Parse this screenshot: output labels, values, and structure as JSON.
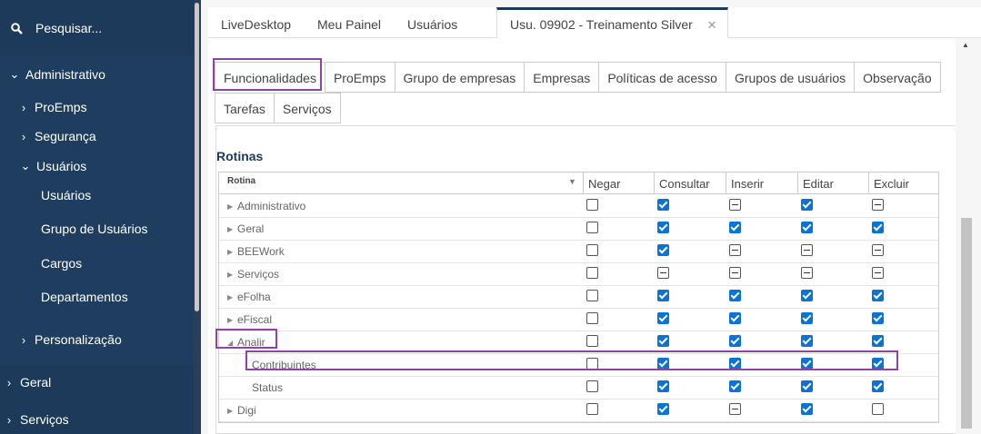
{
  "sidebar": {
    "search_label": "Pesquisar...",
    "items": [
      {
        "label": "Administrativo"
      },
      {
        "label": "ProEmps"
      },
      {
        "label": "Segurança"
      },
      {
        "label": "Usuários"
      },
      {
        "label": "Usuários"
      },
      {
        "label": "Grupo de Usuários"
      },
      {
        "label": "Cargos"
      },
      {
        "label": "Departamentos"
      },
      {
        "label": "Personalização"
      },
      {
        "label": "Geral"
      },
      {
        "label": "Serviços"
      }
    ]
  },
  "top_tabs": [
    "LiveDesktop",
    "Meu Painel",
    "Usuários",
    "Usu. 09902 - Treinamento Silver"
  ],
  "form_tabs_row1": [
    "Funcionalidades",
    "ProEmps",
    "Grupo de empresas",
    "Empresas",
    "Políticas de acesso",
    "Grupos de usuários",
    "Observação"
  ],
  "form_tabs_row2": [
    "Tarefas",
    "Serviços"
  ],
  "section_title": "Rotinas",
  "grid": {
    "columns": [
      "Rotina",
      "Negar",
      "Consultar",
      "Inserir",
      "Editar",
      "Excluir"
    ],
    "rows": [
      {
        "label": "Administrativo",
        "states": [
          "n",
          "c",
          "i",
          "c",
          "i"
        ]
      },
      {
        "label": "Geral",
        "states": [
          "n",
          "c",
          "c",
          "c",
          "c"
        ]
      },
      {
        "label": "BEEWork",
        "states": [
          "n",
          "c",
          "i",
          "i",
          "i"
        ]
      },
      {
        "label": "Serviços",
        "states": [
          "n",
          "i",
          "i",
          "i",
          "i"
        ]
      },
      {
        "label": "eFolha",
        "states": [
          "n",
          "c",
          "c",
          "c",
          "c"
        ]
      },
      {
        "label": "eFiscal",
        "states": [
          "n",
          "c",
          "c",
          "c",
          "c"
        ]
      },
      {
        "label": "Analir",
        "states": [
          "n",
          "c",
          "c",
          "c",
          "c"
        ]
      },
      {
        "label": "Contribuintes",
        "states": [
          "n",
          "c",
          "c",
          "c",
          "c"
        ]
      },
      {
        "label": "Status",
        "states": [
          "n",
          "c",
          "c",
          "c",
          "c"
        ]
      },
      {
        "label": "Digi",
        "states": [
          "n",
          "c",
          "i",
          "c",
          "n"
        ]
      }
    ]
  }
}
